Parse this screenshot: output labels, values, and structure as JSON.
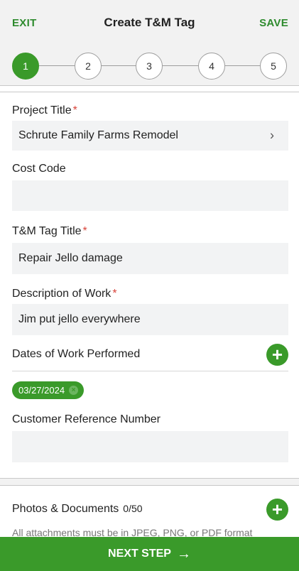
{
  "header": {
    "exit_label": "EXIT",
    "title": "Create T&M Tag",
    "save_label": "SAVE"
  },
  "stepper": {
    "steps": [
      "1",
      "2",
      "3",
      "4",
      "5"
    ],
    "active_step": 1
  },
  "form": {
    "required_marker": "*",
    "project_title": {
      "label": "Project Title",
      "value": "Schrute Family Farms Remodel",
      "chevron": "›"
    },
    "cost_code": {
      "label": "Cost Code",
      "value": ""
    },
    "tag_title": {
      "label": "T&M Tag Title",
      "value": "Repair Jello damage"
    },
    "description": {
      "label": "Description of Work",
      "value": "Jim put jello everywhere"
    },
    "dates": {
      "label": "Dates of Work Performed",
      "add_icon": "+",
      "chip": "03/27/2024",
      "chip_remove": "×"
    },
    "customer_ref": {
      "label": "Customer Reference Number",
      "value": ""
    }
  },
  "photos": {
    "label": "Photos & Documents",
    "count": "0/50",
    "add_icon": "+",
    "note": "All attachments must be in JPEG, PNG, or PDF format"
  },
  "footer": {
    "next_label": "NEXT STEP",
    "arrow": "→"
  },
  "colors": {
    "accent": "#3a9a2a",
    "header_text_green": "#2e8b2e",
    "required_red": "#d9443b",
    "field_bg": "#f2f3f4"
  }
}
